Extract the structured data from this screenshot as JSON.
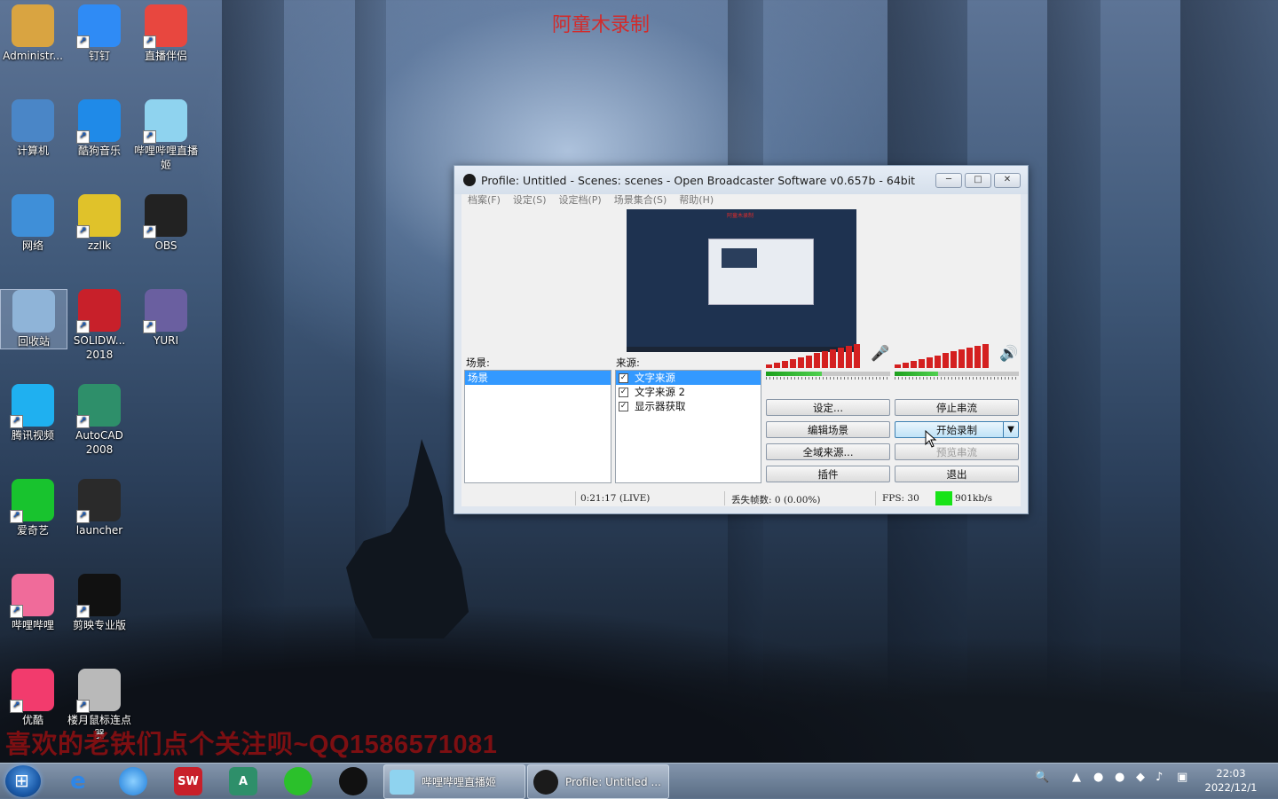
{
  "desktop": {
    "top_caption": "阿童木录制",
    "bottom_caption": "喜欢的老铁们点个关注呗~QQ1586571081",
    "icons": [
      {
        "label": "Administr...",
        "icon": "folder-user-icon",
        "color": "#d9a441"
      },
      {
        "label": "钉钉",
        "icon": "dingtalk-icon",
        "color": "#2f8bf5"
      },
      {
        "label": "直播伴侣",
        "icon": "live-companion-icon",
        "color": "#e8473f"
      },
      {
        "label": "计算机",
        "icon": "computer-icon",
        "color": "#4a86c7"
      },
      {
        "label": "酷狗音乐",
        "icon": "kugou-icon",
        "color": "#1f8ae8"
      },
      {
        "label": "哔哩哔哩直播姬",
        "icon": "bilibili-live-icon",
        "color": "#8fd3ef"
      },
      {
        "label": "网络",
        "icon": "network-icon",
        "color": "#3f8fd8"
      },
      {
        "label": "zzllk",
        "icon": "zzllk-icon",
        "color": "#e0c22a"
      },
      {
        "label": "OBS",
        "icon": "obs-icon",
        "color": "#222222"
      },
      {
        "label": "回收站",
        "icon": "recycle-bin-icon",
        "color": "#8fb4d8"
      },
      {
        "label": "SOLIDW...\n2018",
        "icon": "solidworks-icon",
        "color": "#c8202a"
      },
      {
        "label": "YURI",
        "icon": "yuri-icon",
        "color": "#6a5fa0"
      },
      {
        "label": "腾讯视频",
        "icon": "tencent-video-icon",
        "color": "#1fb0f0"
      },
      {
        "label": "AutoCAD\n2008",
        "icon": "autocad-icon",
        "color": "#2e8f6a"
      },
      {
        "label": "爱奇艺",
        "icon": "iqiyi-icon",
        "color": "#18c32e"
      },
      {
        "label": "launcher",
        "icon": "launcher-icon",
        "color": "#2a2a2a"
      },
      {
        "label": "哔哩哔哩",
        "icon": "bilibili-icon",
        "color": "#f06b9a"
      },
      {
        "label": "剪映专业版",
        "icon": "capcut-icon",
        "color": "#111111"
      },
      {
        "label": "优酷",
        "icon": "youku-icon",
        "color": "#f23b6d"
      },
      {
        "label": "楼月鼠标连点器",
        "icon": "mouse-clicker-icon",
        "color": "#b9b9b9"
      }
    ]
  },
  "obs": {
    "title": "Profile: Untitled - Scenes: scenes - Open Broadcaster Software v0.657b - 64bit",
    "window_buttons": {
      "minimize": "─",
      "maximize": "□",
      "close": "✕"
    },
    "menu": [
      "档案(F)",
      "设定(S)",
      "设定档(P)",
      "场景集合(S)",
      "帮助(H)"
    ],
    "preview_caption": "阿童木录制",
    "scenes_label": "场景:",
    "scenes": [
      "场景"
    ],
    "sources_label": "来源:",
    "sources": [
      {
        "label": "文字来源",
        "checked": "✓"
      },
      {
        "label": "文字来源 2",
        "checked": "✓"
      },
      {
        "label": "显示器获取",
        "checked": "✓"
      }
    ],
    "mic_level": 0.45,
    "desktop_level": 0.35,
    "mic_icon": "microphone-icon",
    "speaker_icon": "speaker-icon",
    "buttons": {
      "settings": "设定...",
      "stop_stream": "停止串流",
      "edit_scene": "编辑场景",
      "start_record": "开始录制",
      "record_dropdown": "▼",
      "global_sources": "全域来源...",
      "preview_stream": "预览串流",
      "plugins": "插件",
      "exit": "退出"
    },
    "status": {
      "time": "0:21:17  (LIVE)",
      "dropped_frames": "丢失帧数: 0 (0.00%)",
      "fps": "FPS: 30",
      "bitrate": "901kb/s",
      "bitrate_color": "#18e318"
    }
  },
  "taskbar": {
    "tasks": [
      {
        "label": "哔哩哔哩直播姬"
      },
      {
        "label": "Profile: Untitled ..."
      }
    ],
    "clock_time": "22:03",
    "clock_date": "2022/12/1"
  }
}
